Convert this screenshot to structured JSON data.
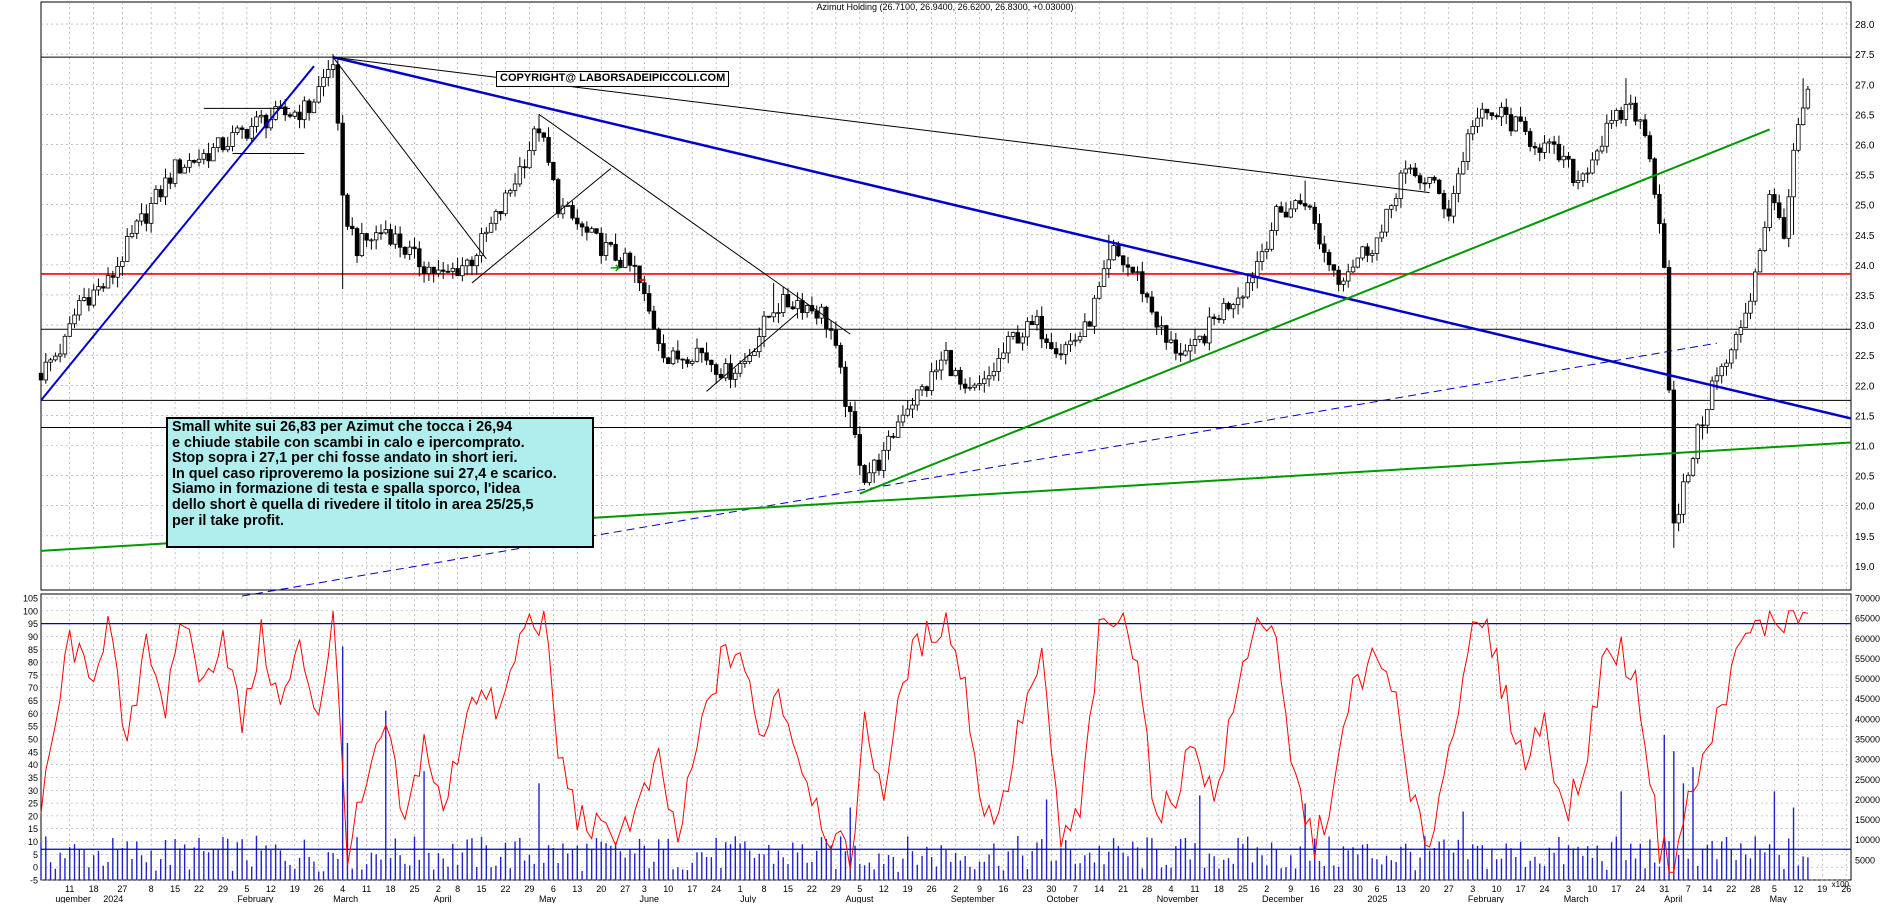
{
  "title": "Azimut Holding (26.7100, 26.9400, 26.6200, 26.8300, +0.03000)",
  "copyright": "COPYRIGHT@ LABORSADEIPICCOLI.COM",
  "note_lines": [
    "Small white sui 26,83 per Azimut che tocca i 26,94",
    "e chiude stabile con scambi in calo e ipercomprato.",
    "Stop sopra i 27,1 per chi fosse andato in short ieri.",
    "In quel caso riproveremo la posizione sui 27,4 e scarico.",
    "Siamo in formazione di testa e spalla sporco, l'idea",
    "dello short è quella di rivedere il titolo in area 25/25,5",
    "per il take profit."
  ],
  "volume_corner_label": "x100",
  "colors": {
    "grid": "#9a9a9a",
    "candle": "#000000",
    "red_line": "#ff0000",
    "blue_line": "#0000cc",
    "green_line": "#009900",
    "oscillator": "#ff0000",
    "volume": "#2222cc"
  },
  "chart_data": {
    "type": "candlestick",
    "price_axis": {
      "range": [
        18.6,
        28.2
      ],
      "ticks": [
        "28.0",
        "27.5",
        "27.0",
        "26.5",
        "26.0",
        "25.5",
        "25.0",
        "24.5",
        "24.0",
        "23.5",
        "23.0",
        "22.5",
        "22.0",
        "21.5",
        "21.0",
        "20.5",
        "20.0",
        "19.5",
        "19.0"
      ]
    },
    "oscillator_axis": {
      "range": [
        -5,
        105
      ],
      "ticks": [
        "105",
        "100",
        "95",
        "90",
        "85",
        "80",
        "75",
        "70",
        "65",
        "60",
        "55",
        "50",
        "45",
        "40",
        "35",
        "30",
        "25",
        "20",
        "15",
        "10",
        "5",
        "0",
        "-5"
      ],
      "upper_level": 95,
      "lower_level": 7
    },
    "volume_axis": {
      "range": [
        0,
        70000
      ],
      "ticks": [
        "70000",
        "65000",
        "60000",
        "55000",
        "50000",
        "45000",
        "40000",
        "35000",
        "30000",
        "25000",
        "20000",
        "15000",
        "10000",
        "5000"
      ]
    },
    "x_ticks": [
      {
        "label": "11",
        "day": 6
      },
      {
        "label": "18",
        "day": 11
      },
      {
        "label": "27",
        "day": 17
      },
      {
        "label": "8",
        "day": 23
      },
      {
        "label": "15",
        "day": 28
      },
      {
        "label": "22",
        "day": 33
      },
      {
        "label": "29",
        "day": 38
      },
      {
        "label": "5",
        "day": 43
      },
      {
        "label": "12",
        "day": 48
      },
      {
        "label": "19",
        "day": 53
      },
      {
        "label": "26",
        "day": 58
      },
      {
        "label": "4",
        "day": 63
      },
      {
        "label": "11",
        "day": 68
      },
      {
        "label": "18",
        "day": 73
      },
      {
        "label": "25",
        "day": 78
      },
      {
        "label": "2",
        "day": 83
      },
      {
        "label": "8",
        "day": 87
      },
      {
        "label": "15",
        "day": 92
      },
      {
        "label": "22",
        "day": 97
      },
      {
        "label": "29",
        "day": 102
      },
      {
        "label": "6",
        "day": 107
      },
      {
        "label": "13",
        "day": 112
      },
      {
        "label": "20",
        "day": 117
      },
      {
        "label": "27",
        "day": 122
      },
      {
        "label": "3",
        "day": 126
      },
      {
        "label": "10",
        "day": 131
      },
      {
        "label": "17",
        "day": 136
      },
      {
        "label": "24",
        "day": 141
      },
      {
        "label": "1",
        "day": 146
      },
      {
        "label": "8",
        "day": 151
      },
      {
        "label": "15",
        "day": 156
      },
      {
        "label": "22",
        "day": 161
      },
      {
        "label": "29",
        "day": 166
      },
      {
        "label": "5",
        "day": 171
      },
      {
        "label": "12",
        "day": 176
      },
      {
        "label": "19",
        "day": 181
      },
      {
        "label": "26",
        "day": 186
      },
      {
        "label": "2",
        "day": 191
      },
      {
        "label": "9",
        "day": 196
      },
      {
        "label": "16",
        "day": 201
      },
      {
        "label": "23",
        "day": 206
      },
      {
        "label": "30",
        "day": 211
      },
      {
        "label": "7",
        "day": 216
      },
      {
        "label": "14",
        "day": 221
      },
      {
        "label": "21",
        "day": 226
      },
      {
        "label": "28",
        "day": 231
      },
      {
        "label": "4",
        "day": 236
      },
      {
        "label": "11",
        "day": 241
      },
      {
        "label": "18",
        "day": 246
      },
      {
        "label": "25",
        "day": 251
      },
      {
        "label": "2",
        "day": 256
      },
      {
        "label": "9",
        "day": 261
      },
      {
        "label": "16",
        "day": 266
      },
      {
        "label": "23",
        "day": 271
      },
      {
        "label": "30",
        "day": 275
      },
      {
        "label": "6",
        "day": 279
      },
      {
        "label": "13",
        "day": 284
      },
      {
        "label": "20",
        "day": 289
      },
      {
        "label": "27",
        "day": 294
      },
      {
        "label": "3",
        "day": 299
      },
      {
        "label": "10",
        "day": 304
      },
      {
        "label": "17",
        "day": 309
      },
      {
        "label": "24",
        "day": 314
      },
      {
        "label": "3",
        "day": 319
      },
      {
        "label": "10",
        "day": 324
      },
      {
        "label": "17",
        "day": 329
      },
      {
        "label": "24",
        "day": 334
      },
      {
        "label": "31",
        "day": 339
      },
      {
        "label": "7",
        "day": 344
      },
      {
        "label": "14",
        "day": 348
      },
      {
        "label": "22",
        "day": 353
      },
      {
        "label": "28",
        "day": 358
      },
      {
        "label": "5",
        "day": 362
      },
      {
        "label": "12",
        "day": 367
      },
      {
        "label": "19",
        "day": 372
      },
      {
        "label": "26",
        "day": 377
      }
    ],
    "month_labels": [
      {
        "label": "ugember",
        "day": 3
      },
      {
        "label": "2024",
        "day": 13
      },
      {
        "label": "February",
        "day": 41
      },
      {
        "label": "March",
        "day": 61
      },
      {
        "label": "April",
        "day": 82
      },
      {
        "label": "May",
        "day": 104
      },
      {
        "label": "June",
        "day": 125
      },
      {
        "label": "July",
        "day": 146
      },
      {
        "label": "August",
        "day": 168
      },
      {
        "label": "September",
        "day": 190
      },
      {
        "label": "October",
        "day": 210
      },
      {
        "label": "November",
        "day": 233
      },
      {
        "label": "December",
        "day": 255
      },
      {
        "label": "2025",
        "day": 277
      },
      {
        "label": "February",
        "day": 298
      },
      {
        "label": "March",
        "day": 318
      },
      {
        "label": "April",
        "day": 339
      },
      {
        "label": "May",
        "day": 361
      }
    ],
    "price_key_points": [
      [
        0,
        22.2
      ],
      [
        5,
        22.7
      ],
      [
        8,
        23.4
      ],
      [
        14,
        23.7
      ],
      [
        20,
        24.6
      ],
      [
        28,
        25.6
      ],
      [
        36,
        25.9
      ],
      [
        46,
        26.4
      ],
      [
        56,
        26.6
      ],
      [
        61,
        27.4
      ],
      [
        63,
        25.0
      ],
      [
        66,
        24.3
      ],
      [
        72,
        24.6
      ],
      [
        78,
        24.1
      ],
      [
        84,
        23.8
      ],
      [
        90,
        24.1
      ],
      [
        96,
        24.9
      ],
      [
        104,
        26.3
      ],
      [
        108,
        25.0
      ],
      [
        114,
        24.5
      ],
      [
        124,
        23.9
      ],
      [
        127,
        23.2
      ],
      [
        131,
        22.4
      ],
      [
        137,
        22.6
      ],
      [
        143,
        22.2
      ],
      [
        147,
        22.4
      ],
      [
        153,
        23.3
      ],
      [
        158,
        23.4
      ],
      [
        163,
        23.2
      ],
      [
        165,
        22.9
      ],
      [
        169,
        21.4
      ],
      [
        172,
        20.5
      ],
      [
        176,
        20.8
      ],
      [
        180,
        21.6
      ],
      [
        185,
        22.0
      ],
      [
        189,
        22.5
      ],
      [
        193,
        21.8
      ],
      [
        197,
        22.0
      ],
      [
        203,
        22.8
      ],
      [
        208,
        23.0
      ],
      [
        213,
        22.6
      ],
      [
        218,
        22.9
      ],
      [
        224,
        24.2
      ],
      [
        229,
        23.8
      ],
      [
        235,
        22.7
      ],
      [
        240,
        22.5
      ],
      [
        246,
        23.2
      ],
      [
        252,
        23.7
      ],
      [
        258,
        24.8
      ],
      [
        264,
        25.1
      ],
      [
        268,
        24.2
      ],
      [
        271,
        23.8
      ],
      [
        276,
        24.2
      ],
      [
        280,
        24.5
      ],
      [
        284,
        25.5
      ],
      [
        290,
        25.4
      ],
      [
        294,
        24.9
      ],
      [
        299,
        26.4
      ],
      [
        305,
        26.5
      ],
      [
        311,
        26.1
      ],
      [
        317,
        25.8
      ],
      [
        321,
        25.4
      ],
      [
        327,
        26.2
      ],
      [
        332,
        26.7
      ],
      [
        336,
        25.9
      ],
      [
        339,
        24.1
      ],
      [
        341,
        19.6
      ],
      [
        345,
        20.9
      ],
      [
        349,
        22.0
      ],
      [
        353,
        22.5
      ],
      [
        357,
        23.5
      ],
      [
        361,
        25.1
      ],
      [
        364,
        24.6
      ],
      [
        367,
        26.3
      ],
      [
        369,
        26.8
      ]
    ],
    "price_spikes": [
      {
        "day": 61,
        "high": 27.5
      },
      {
        "day": 63,
        "low": 23.6
      },
      {
        "day": 104,
        "high": 26.5
      },
      {
        "day": 124,
        "low": 23.7
      },
      {
        "day": 153,
        "high": 23.7
      },
      {
        "day": 169,
        "low": 21.3
      },
      {
        "day": 223,
        "high": 24.5
      },
      {
        "day": 264,
        "high": 25.4
      },
      {
        "day": 331,
        "high": 27.1
      },
      {
        "day": 341,
        "low": 19.3
      },
      {
        "day": 347,
        "low": 21.1
      },
      {
        "day": 366,
        "low": 24.5
      },
      {
        "day": 368,
        "high": 27.1
      }
    ],
    "horizontal_levels": [
      {
        "name": "red-resistance",
        "value": 23.85,
        "color": "red"
      },
      {
        "name": "black-level-top",
        "value": 27.45,
        "color": "black"
      },
      {
        "name": "black-level-22.9",
        "value": 22.93,
        "color": "black"
      },
      {
        "name": "black-level-21.7",
        "value": 21.75,
        "color": "black"
      },
      {
        "name": "black-level-21.3",
        "value": 21.3,
        "color": "black"
      }
    ],
    "trendlines": [
      {
        "name": "blue-uptrend",
        "color": "blue",
        "width": 2,
        "from": [
          0,
          21.75
        ],
        "to": [
          57,
          27.3
        ]
      },
      {
        "name": "blue-downtrend",
        "color": "blue",
        "width": 2.5,
        "from": [
          61,
          27.45
        ],
        "to": [
          378,
          21.45
        ]
      },
      {
        "name": "blue-dashed-support",
        "color": "blue",
        "width": 1,
        "dashed": true,
        "from": [
          42,
          18.5
        ],
        "to": [
          350,
          22.7
        ]
      },
      {
        "name": "green-long-support",
        "color": "green",
        "width": 2,
        "from": [
          0,
          19.25
        ],
        "to": [
          378,
          21.05
        ]
      },
      {
        "name": "green-uptrend",
        "color": "green",
        "width": 2,
        "from": [
          171,
          20.2
        ],
        "to": [
          361,
          26.25
        ]
      },
      {
        "name": "black-neckline",
        "color": "black",
        "width": 1,
        "from": [
          61,
          27.45
        ],
        "to": [
          290,
          25.2
        ]
      },
      {
        "name": "black-fall-1",
        "color": "black",
        "width": 1,
        "from": [
          61,
          27.45
        ],
        "to": [
          93,
          24.1
        ]
      },
      {
        "name": "black-fall-2",
        "color": "black",
        "width": 1,
        "from": [
          104,
          26.5
        ],
        "to": [
          169,
          22.85
        ]
      },
      {
        "name": "black-channel-1",
        "color": "black",
        "width": 1,
        "from": [
          90,
          23.7
        ],
        "to": [
          119,
          25.6
        ]
      },
      {
        "name": "black-channel-2",
        "color": "black",
        "width": 1,
        "from": [
          139,
          21.9
        ],
        "to": [
          158,
          23.2
        ]
      },
      {
        "name": "black-range-top",
        "color": "black",
        "width": 1,
        "from": [
          34,
          26.6
        ],
        "to": [
          52,
          26.6
        ]
      },
      {
        "name": "black-range-bottom",
        "color": "black",
        "width": 1,
        "from": [
          40,
          25.85
        ],
        "to": [
          55,
          25.85
        ]
      }
    ],
    "volume_spikes": [
      {
        "day": 63,
        "value": 58000
      },
      {
        "day": 64,
        "value": 34000
      },
      {
        "day": 72,
        "value": 42000
      },
      {
        "day": 80,
        "value": 27000
      },
      {
        "day": 104,
        "value": 24000
      },
      {
        "day": 169,
        "value": 18000
      },
      {
        "day": 210,
        "value": 20000
      },
      {
        "day": 242,
        "value": 21000
      },
      {
        "day": 264,
        "value": 19000
      },
      {
        "day": 297,
        "value": 17000
      },
      {
        "day": 330,
        "value": 22000
      },
      {
        "day": 339,
        "value": 36000
      },
      {
        "day": 341,
        "value": 32000
      },
      {
        "day": 343,
        "value": 24000
      },
      {
        "day": 345,
        "value": 28000
      },
      {
        "day": 362,
        "value": 22000
      },
      {
        "day": 366,
        "value": 18000
      }
    ],
    "oscillator_peaks": [
      [
        0,
        20
      ],
      [
        6,
        90
      ],
      [
        10,
        72
      ],
      [
        14,
        95
      ],
      [
        18,
        45
      ],
      [
        22,
        92
      ],
      [
        26,
        62
      ],
      [
        30,
        97
      ],
      [
        34,
        70
      ],
      [
        38,
        93
      ],
      [
        42,
        55
      ],
      [
        46,
        90
      ],
      [
        50,
        62
      ],
      [
        54,
        85
      ],
      [
        58,
        60
      ],
      [
        61,
        98
      ],
      [
        64,
        7
      ],
      [
        68,
        30
      ],
      [
        72,
        55
      ],
      [
        76,
        15
      ],
      [
        80,
        50
      ],
      [
        84,
        20
      ],
      [
        90,
        70
      ],
      [
        96,
        60
      ],
      [
        101,
        95
      ],
      [
        105,
        97
      ],
      [
        108,
        45
      ],
      [
        112,
        20
      ],
      [
        118,
        12
      ],
      [
        124,
        20
      ],
      [
        129,
        40
      ],
      [
        133,
        10
      ],
      [
        138,
        55
      ],
      [
        142,
        80
      ],
      [
        146,
        85
      ],
      [
        150,
        50
      ],
      [
        154,
        70
      ],
      [
        158,
        45
      ],
      [
        164,
        15
      ],
      [
        169,
        2
      ],
      [
        172,
        55
      ],
      [
        176,
        30
      ],
      [
        181,
        80
      ],
      [
        185,
        90
      ],
      [
        189,
        97
      ],
      [
        193,
        70
      ],
      [
        197,
        20
      ],
      [
        201,
        25
      ],
      [
        205,
        60
      ],
      [
        209,
        80
      ],
      [
        213,
        10
      ],
      [
        217,
        20
      ],
      [
        221,
        90
      ],
      [
        225,
        97
      ],
      [
        229,
        85
      ],
      [
        233,
        15
      ],
      [
        237,
        30
      ],
      [
        241,
        50
      ],
      [
        245,
        25
      ],
      [
        249,
        60
      ],
      [
        253,
        94
      ],
      [
        257,
        97
      ],
      [
        261,
        40
      ],
      [
        266,
        8
      ],
      [
        270,
        30
      ],
      [
        274,
        70
      ],
      [
        278,
        80
      ],
      [
        282,
        75
      ],
      [
        286,
        25
      ],
      [
        290,
        10
      ],
      [
        294,
        45
      ],
      [
        298,
        88
      ],
      [
        302,
        92
      ],
      [
        306,
        65
      ],
      [
        310,
        40
      ],
      [
        314,
        60
      ],
      [
        318,
        20
      ],
      [
        322,
        35
      ],
      [
        326,
        80
      ],
      [
        330,
        85
      ],
      [
        334,
        65
      ],
      [
        338,
        8
      ],
      [
        341,
        2
      ],
      [
        344,
        25
      ],
      [
        348,
        45
      ],
      [
        352,
        70
      ],
      [
        356,
        90
      ],
      [
        360,
        95
      ],
      [
        363,
        96
      ],
      [
        366,
        98
      ],
      [
        369,
        99
      ]
    ]
  }
}
